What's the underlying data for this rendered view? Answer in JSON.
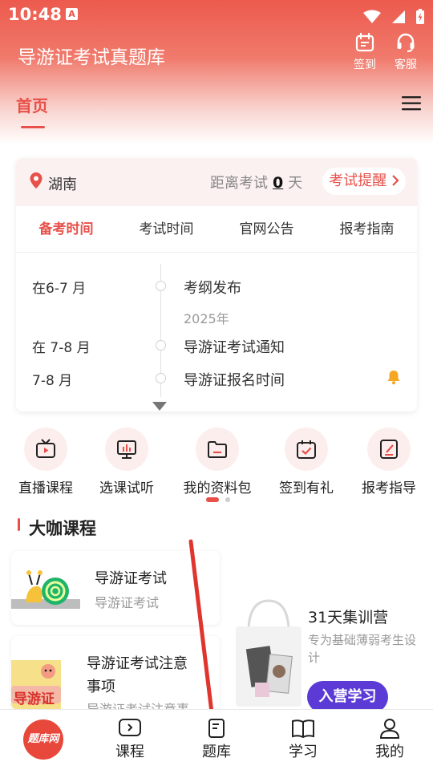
{
  "status_bar": {
    "time": "10:48",
    "app_icon_glyph": "A"
  },
  "header": {
    "title": "导游证考试真题库",
    "actions": [
      {
        "label": "签到",
        "icon": "calendar-icon"
      },
      {
        "label": "客服",
        "icon": "headset-icon"
      }
    ]
  },
  "nav": {
    "home_tab": "首页",
    "menu_icon": "hamburger-menu-icon"
  },
  "exam": {
    "location": "湖南",
    "countdown_prefix": "距离考试",
    "countdown_days": "0",
    "countdown_unit": "天",
    "reminder_button": "考试提醒",
    "tabs": [
      "备考时间",
      "考试时间",
      "官网公告",
      "报考指南"
    ],
    "active_tab": 0,
    "timeline": [
      {
        "date": "在6-7 月",
        "event": "考纲发布",
        "sub": "2025年"
      },
      {
        "date": "在 7-8 月",
        "event": "导游证考试通知"
      },
      {
        "date": "7-8 月",
        "event": "导游证报名时间",
        "has_bell": true
      }
    ]
  },
  "quick_links": [
    {
      "label": "直播课程",
      "icon": "tv-icon"
    },
    {
      "label": "选课试听",
      "icon": "chart-screen-icon"
    },
    {
      "label": "我的资料包",
      "icon": "folder-icon"
    },
    {
      "label": "签到有礼",
      "icon": "calendar-check-icon"
    },
    {
      "label": "报考指导",
      "icon": "edit-doc-icon"
    }
  ],
  "section": {
    "title": "大咖课程"
  },
  "courses": [
    {
      "name": "导游证考试",
      "sub": "导游证考试"
    },
    {
      "name_line1": "导游证考试注意",
      "name_line2": "事项",
      "sub": "导游证考试注意事",
      "thumb_text": "导游证"
    }
  ],
  "camp": {
    "title": "31天集训营",
    "desc": "专为基础薄弱考生设计",
    "button": "入营学习"
  },
  "bottom_nav": {
    "logo_text": "题库网",
    "items": [
      {
        "label": "课程",
        "icon": "play-square-icon"
      },
      {
        "label": "题库",
        "icon": "document-icon"
      },
      {
        "label": "学习",
        "icon": "open-book-icon"
      },
      {
        "label": "我的",
        "icon": "user-icon"
      }
    ]
  },
  "colors": {
    "accent": "#e8504a",
    "camp_button": "#5b3ad6",
    "arrow": "#e0342f"
  }
}
